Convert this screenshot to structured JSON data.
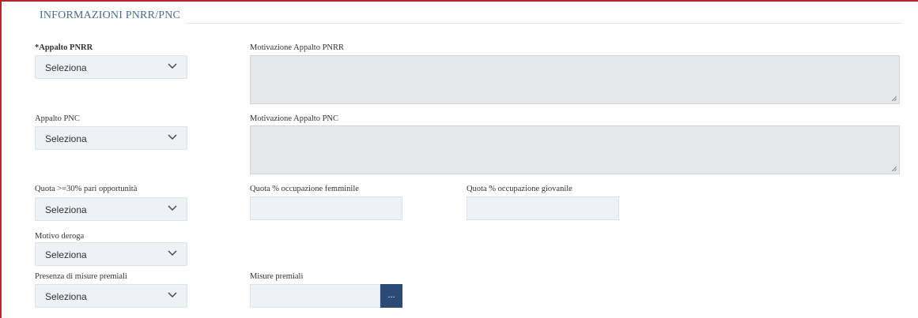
{
  "section": {
    "title": "INFORMAZIONI PNRR/PNC"
  },
  "fields": {
    "appalto_pnrr": {
      "label": "*Appalto PNRR",
      "value": "Seleziona"
    },
    "motivazione_pnrr": {
      "label": "Motivazione Appalto PNRR",
      "value": ""
    },
    "appalto_pnc": {
      "label": "Appalto PNC",
      "value": "Seleziona"
    },
    "motivazione_pnc": {
      "label": "Motivazione Appalto PNC",
      "value": ""
    },
    "quota_pari_opportunita": {
      "label": "Quota >=30% pari opportunità",
      "value": "Seleziona"
    },
    "quota_femminile": {
      "label": "Quota % occupazione femminile",
      "value": ""
    },
    "quota_giovanile": {
      "label": "Quota % occupazione giovanile",
      "value": ""
    },
    "motivo_deroga": {
      "label": "Motivo deroga",
      "value": "Seleziona"
    },
    "presenza_misure_premiali": {
      "label": "Presenza di misure premiali",
      "value": "Seleziona"
    },
    "misure_premiali": {
      "label": "Misure premiali",
      "value": "",
      "button_label": "..."
    }
  },
  "icons": {
    "dropdown": "chevron-down-icon",
    "resize": "resize-grip-icon"
  },
  "colors": {
    "frame_border": "#b3282d",
    "section_title": "#4a6b8a",
    "field_background": "#eef1f5",
    "textarea_background": "#e6e8ea",
    "button_background": "#2b4a75"
  }
}
